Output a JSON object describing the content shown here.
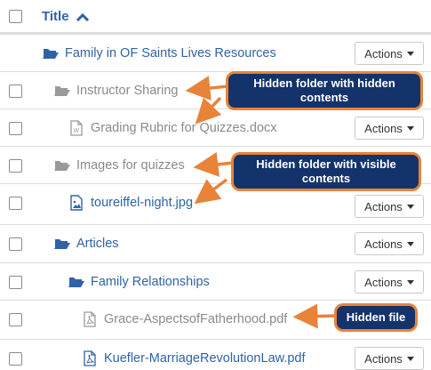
{
  "header": {
    "title_label": "Title"
  },
  "rows": [
    {
      "label": "Family in OF Saints Lives Resources",
      "icon": "folder-open-icon",
      "style": "link",
      "actions": "Actions"
    },
    {
      "label": "Instructor Sharing",
      "icon": "folder-open-icon",
      "style": "hidden",
      "actions": ""
    },
    {
      "label": "Grading Rubric for Quizzes.docx",
      "icon": "word-file-icon",
      "style": "hidden",
      "actions": "Actions"
    },
    {
      "label": "Images for quizzes",
      "icon": "folder-open-icon",
      "style": "hidden",
      "actions": ""
    },
    {
      "label": "toureiffel-night.jpg",
      "icon": "image-file-icon",
      "style": "link",
      "actions": "Actions"
    },
    {
      "label": "Articles",
      "icon": "folder-open-icon",
      "style": "link",
      "actions": "Actions"
    },
    {
      "label": "Family Relationships",
      "icon": "folder-open-icon",
      "style": "link",
      "actions": "Actions"
    },
    {
      "label": "Grace-AspectsofFatherhood.pdf",
      "icon": "pdf-file-icon",
      "style": "hidden",
      "actions": ""
    },
    {
      "label": "Kuefler-MarriageRevolutionLaw.pdf",
      "icon": "pdf-file-icon",
      "style": "link",
      "actions": "Actions"
    }
  ],
  "callouts": {
    "hidden_folder_hidden_contents": "Hidden folder with hidden contents",
    "hidden_folder_visible_contents": "Hidden folder with visible contents",
    "hidden_file": "Hidden file"
  },
  "colors": {
    "link": "#2f63a6",
    "hidden": "#8a8a8a",
    "callout_bg": "#14336b",
    "callout_border": "#e8833a"
  }
}
